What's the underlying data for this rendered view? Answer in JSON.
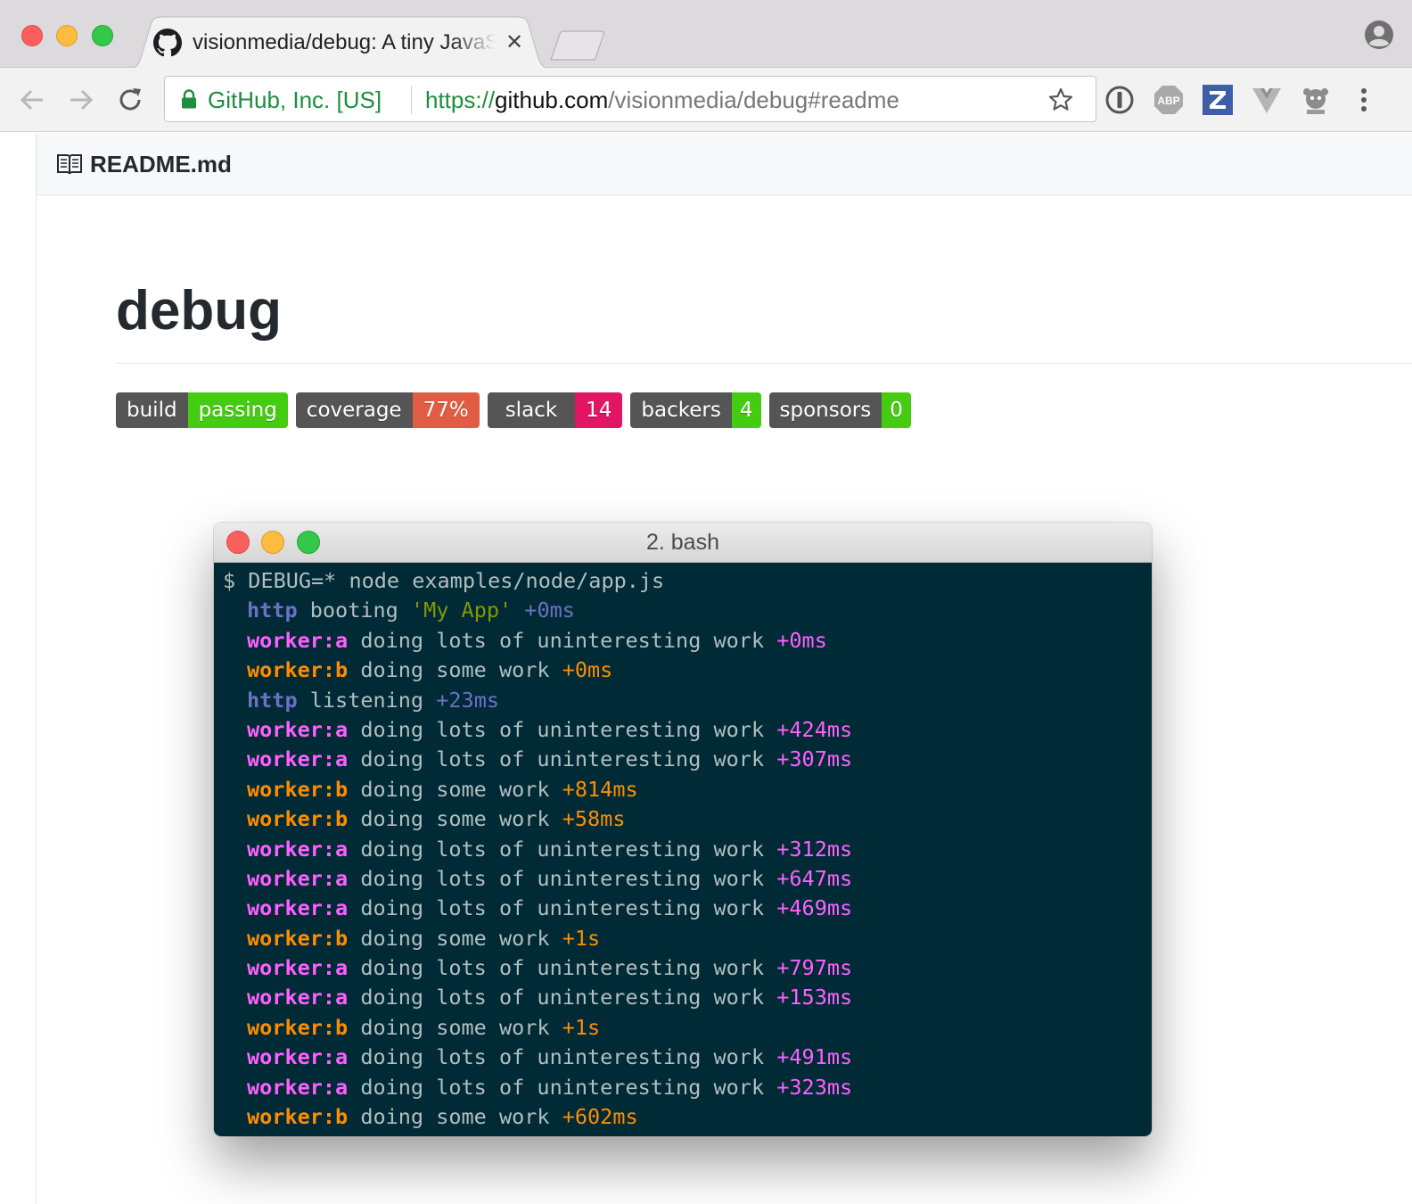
{
  "browser": {
    "tab": {
      "title": "visionmedia/debug: A tiny JavaScript debugging utility",
      "favicon": "github-icon"
    },
    "address": {
      "ev_label": "GitHub, Inc. [US]",
      "scheme": "https://",
      "host": "github.com",
      "path": "/visionmedia/debug#readme"
    },
    "extensions": [
      "1password-icon",
      "adblock-plus-icon",
      "zotero-icon",
      "vue-devtools-icon",
      "extension-icon"
    ]
  },
  "readme": {
    "file_name": "README.md",
    "heading": "debug",
    "badges": [
      {
        "key": "build",
        "value": "passing",
        "color": "#44cc11"
      },
      {
        "key": "coverage",
        "value": "77%",
        "color": "#e05d44"
      },
      {
        "key": "slack",
        "value": "14",
        "color": "#e01563"
      },
      {
        "key": "backers",
        "value": "4",
        "color": "#4c1"
      },
      {
        "key": "sponsors",
        "value": "0",
        "color": "#4c1"
      }
    ]
  },
  "terminal": {
    "title": "2. bash",
    "colors": {
      "http": "#6c71c4",
      "worker_a": "#ff5fff",
      "worker_b": "#ff8c00",
      "string": "#859900",
      "text": "#b2bec0"
    },
    "command": "$ DEBUG=* node examples/node/app.js",
    "lines": [
      {
        "ns": "http",
        "ns_color": "#6c71c4",
        "pre": "booting",
        "str": "'My App'",
        "time": "+0ms"
      },
      {
        "ns": "worker:a",
        "ns_color": "#ff5fff",
        "pre": "doing lots of uninteresting work",
        "str": "",
        "time": "+0ms"
      },
      {
        "ns": "worker:b",
        "ns_color": "#ff8c00",
        "pre": "doing some work",
        "str": "",
        "time": "+0ms"
      },
      {
        "ns": "http",
        "ns_color": "#6c71c4",
        "pre": "listening",
        "str": "",
        "time": "+23ms"
      },
      {
        "ns": "worker:a",
        "ns_color": "#ff5fff",
        "pre": "doing lots of uninteresting work",
        "str": "",
        "time": "+424ms"
      },
      {
        "ns": "worker:a",
        "ns_color": "#ff5fff",
        "pre": "doing lots of uninteresting work",
        "str": "",
        "time": "+307ms"
      },
      {
        "ns": "worker:b",
        "ns_color": "#ff8c00",
        "pre": "doing some work",
        "str": "",
        "time": "+814ms"
      },
      {
        "ns": "worker:b",
        "ns_color": "#ff8c00",
        "pre": "doing some work",
        "str": "",
        "time": "+58ms"
      },
      {
        "ns": "worker:a",
        "ns_color": "#ff5fff",
        "pre": "doing lots of uninteresting work",
        "str": "",
        "time": "+312ms"
      },
      {
        "ns": "worker:a",
        "ns_color": "#ff5fff",
        "pre": "doing lots of uninteresting work",
        "str": "",
        "time": "+647ms"
      },
      {
        "ns": "worker:a",
        "ns_color": "#ff5fff",
        "pre": "doing lots of uninteresting work",
        "str": "",
        "time": "+469ms"
      },
      {
        "ns": "worker:b",
        "ns_color": "#ff8c00",
        "pre": "doing some work",
        "str": "",
        "time": "+1s"
      },
      {
        "ns": "worker:a",
        "ns_color": "#ff5fff",
        "pre": "doing lots of uninteresting work",
        "str": "",
        "time": "+797ms"
      },
      {
        "ns": "worker:a",
        "ns_color": "#ff5fff",
        "pre": "doing lots of uninteresting work",
        "str": "",
        "time": "+153ms"
      },
      {
        "ns": "worker:b",
        "ns_color": "#ff8c00",
        "pre": "doing some work",
        "str": "",
        "time": "+1s"
      },
      {
        "ns": "worker:a",
        "ns_color": "#ff5fff",
        "pre": "doing lots of uninteresting work",
        "str": "",
        "time": "+491ms"
      },
      {
        "ns": "worker:a",
        "ns_color": "#ff5fff",
        "pre": "doing lots of uninteresting work",
        "str": "",
        "time": "+323ms"
      },
      {
        "ns": "worker:b",
        "ns_color": "#ff8c00",
        "pre": "doing some work",
        "str": "",
        "time": "+602ms"
      }
    ]
  }
}
